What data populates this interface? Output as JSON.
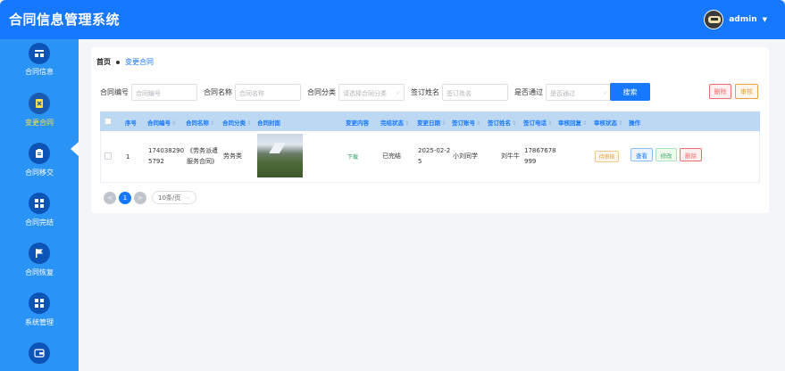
{
  "app": {
    "title": "合同信息管理系统"
  },
  "user": {
    "name": "admin"
  },
  "sidebar": {
    "items": [
      {
        "label": "合同信息",
        "icon": "list-icon",
        "active": false
      },
      {
        "label": "变更合同",
        "icon": "document-x-icon",
        "active": true
      },
      {
        "label": "合同移交",
        "icon": "clipboard-icon",
        "active": false
      },
      {
        "label": "合同完结",
        "icon": "grid-icon",
        "active": false
      },
      {
        "label": "合同恢复",
        "icon": "flag-icon",
        "active": false
      },
      {
        "label": "系统管理",
        "icon": "grid-icon",
        "active": false
      },
      {
        "label": "",
        "icon": "wallet-icon",
        "active": false
      }
    ]
  },
  "breadcrumb": {
    "home": "首页",
    "current": "变更合同"
  },
  "filters": {
    "contract_no": {
      "label": "合同编号",
      "placeholder": "合同编号"
    },
    "contract_name": {
      "label": "合同名称",
      "placeholder": "合同名称"
    },
    "category": {
      "label": "合同分类",
      "placeholder": "请选择合同分类"
    },
    "signer": {
      "label": "签订姓名",
      "placeholder": "签订姓名"
    },
    "passed": {
      "label": "是否通过",
      "placeholder": "是否通过"
    },
    "search_label": "搜索"
  },
  "toolbar": {
    "delete_label": "删除",
    "audit_label": "审核"
  },
  "table": {
    "headers": {
      "index": "序号",
      "contract_no": "合同编号",
      "contract_name": "合同名称",
      "category": "合同分类",
      "cover": "合同封面",
      "change_content": "变更内容",
      "finish_status": "完结状态",
      "change_date": "变更日期",
      "signer_account": "签订账号",
      "signer_name": "签订姓名",
      "signer_phone": "签订电话",
      "audit_reply": "审核回复",
      "audit_status": "审核状态",
      "actions": "操作"
    },
    "rows": [
      {
        "index": "1",
        "contract_no": "1740382905792",
        "contract_name": "《劳务派遣服务合同》",
        "category": "劳务类",
        "change_content": "下载",
        "finish_status": "已完结",
        "change_date": "2025-02-25",
        "signer_account": "小刘同学",
        "signer_name": "刘牛牛",
        "signer_phone": "17867678999",
        "audit_reply": "",
        "audit_status": "待审核",
        "view_label": "查看",
        "edit_label": "修改",
        "delete_label": "删除"
      }
    ]
  },
  "pagination": {
    "prev": "<",
    "current": "1",
    "next": ">",
    "page_size": "10条/页"
  },
  "colors": {
    "primary": "#1677ff",
    "sidebar": "#2a93f6",
    "active_label": "#ffe04a",
    "danger": "#f56c6c",
    "warning": "#e6a23c",
    "success": "#37b570"
  }
}
